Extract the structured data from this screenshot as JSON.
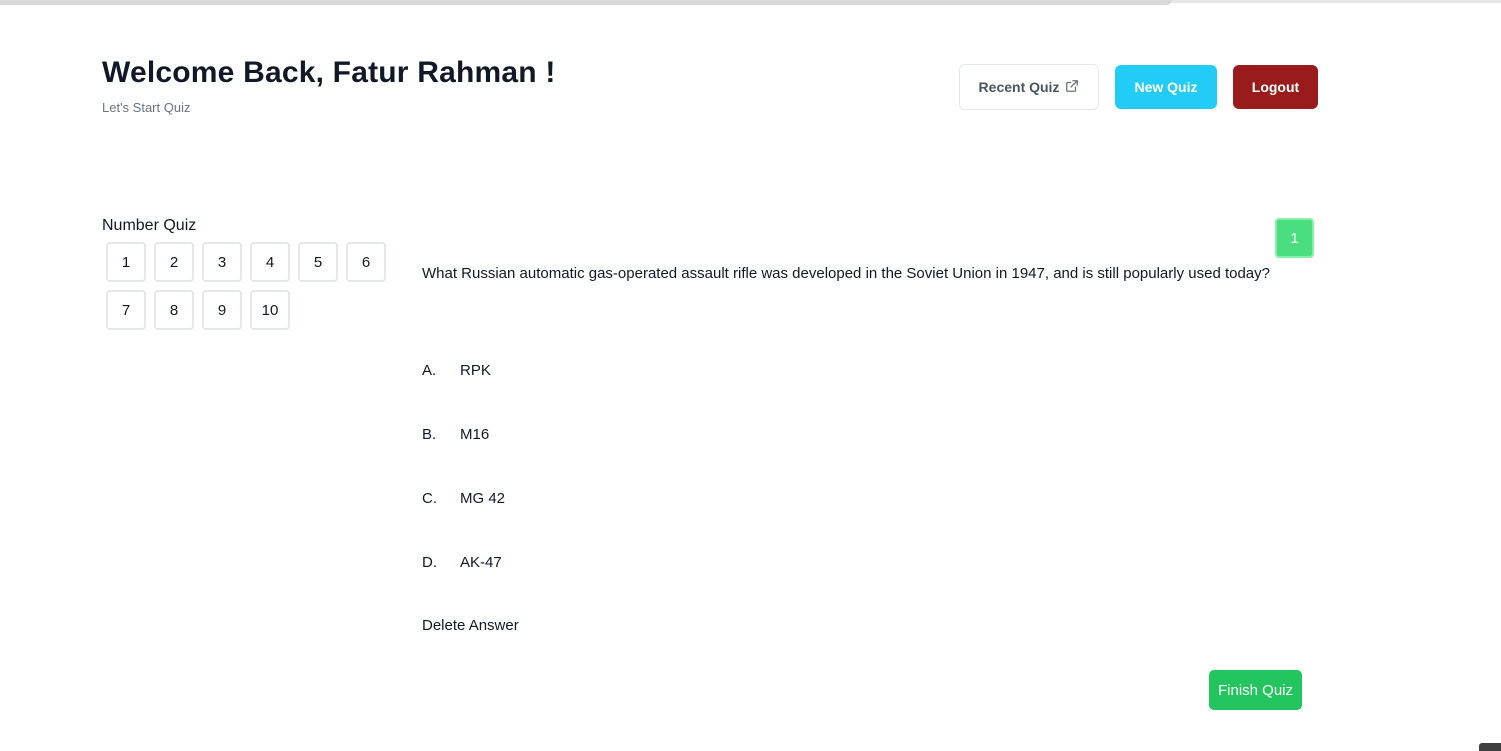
{
  "header": {
    "title": "Welcome Back, Fatur Rahman !",
    "subtitle": "Let's Start Quiz",
    "recent_quiz_label": "Recent Quiz",
    "recent_quiz_icon": "external-link-icon",
    "new_quiz_label": "New Quiz",
    "logout_label": "Logout"
  },
  "nav": {
    "title": "Number Quiz",
    "numbers": [
      "1",
      "2",
      "3",
      "4",
      "5",
      "6",
      "7",
      "8",
      "9",
      "10"
    ]
  },
  "quiz": {
    "current_number": "1",
    "question": "What Russian automatic gas-operated assault rifle was developed in the Soviet Union in 1947, and is still popularly used today?",
    "options": [
      {
        "letter": "A.",
        "text": "RPK"
      },
      {
        "letter": "B.",
        "text": "M16"
      },
      {
        "letter": "C.",
        "text": "MG 42"
      },
      {
        "letter": "D.",
        "text": "AK-47"
      }
    ],
    "delete_answer_label": "Delete Answer",
    "finish_label": "Finish Quiz"
  },
  "colors": {
    "new_quiz": "#22ccf7",
    "logout": "#991b1b",
    "current_badge": "#4ade80",
    "finish": "#22c55e"
  }
}
